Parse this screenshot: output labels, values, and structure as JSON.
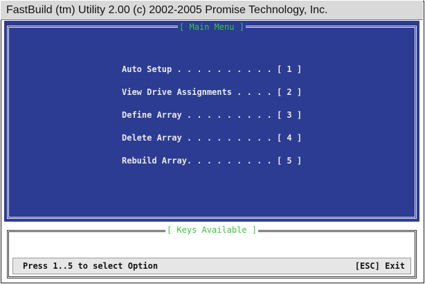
{
  "window": {
    "title": "FastBuild (tm) Utility 2.00 (c) 2002-2005 Promise Technology, Inc."
  },
  "main_menu": {
    "title": "[ Main Menu ]",
    "items": [
      {
        "label": "Auto Setup . . . . . . . . . . [ 1 ]"
      },
      {
        "label": "View Drive Assignments . . . . [ 2 ]"
      },
      {
        "label": "Define Array . . . . . . . . . [ 3 ]"
      },
      {
        "label": "Delete Array . . . . . . . . . [ 4 ]"
      },
      {
        "label": "Rebuild Array. . . . . . . . . [ 5 ]"
      }
    ]
  },
  "keys_panel": {
    "title": "[ Keys Available ]",
    "hint": "Press 1..5 to select Option",
    "exit_label": "[ESC] Exit"
  },
  "colors": {
    "background_blue": "#2b3c92",
    "title_green": "#3fc03f",
    "text_light": "#e8e8e8"
  }
}
